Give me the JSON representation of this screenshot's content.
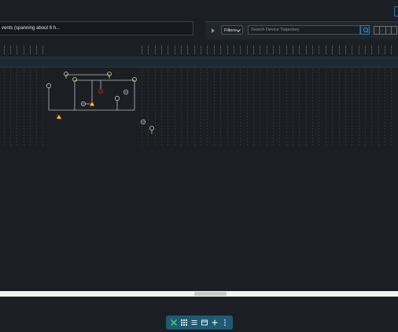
{
  "header": {
    "summary_text": "vents (spanning about 6 h..."
  },
  "search": {
    "filters_label": "Filters",
    "placeholder": "Search Device Trajectory"
  },
  "icons": {
    "play": "play-icon",
    "filters_dropdown": "chevron-down-icon",
    "search": "search-icon",
    "error_marker": "warning-triangle-icon",
    "event_marker": "circle-node-icon"
  },
  "colors": {
    "trajectory_line": "#c7e07a",
    "connector_line": "#b8bec6",
    "warning": "#d9262b",
    "warning_inner": "#f0c419",
    "toolbar_bg": "#1d5b73",
    "toolbar_accent": "#48d26a"
  },
  "toolbar": {
    "items": [
      "close-icon",
      "grid-icon",
      "list-icon",
      "export-icon",
      "add-icon",
      "more-vertical-icon"
    ]
  }
}
